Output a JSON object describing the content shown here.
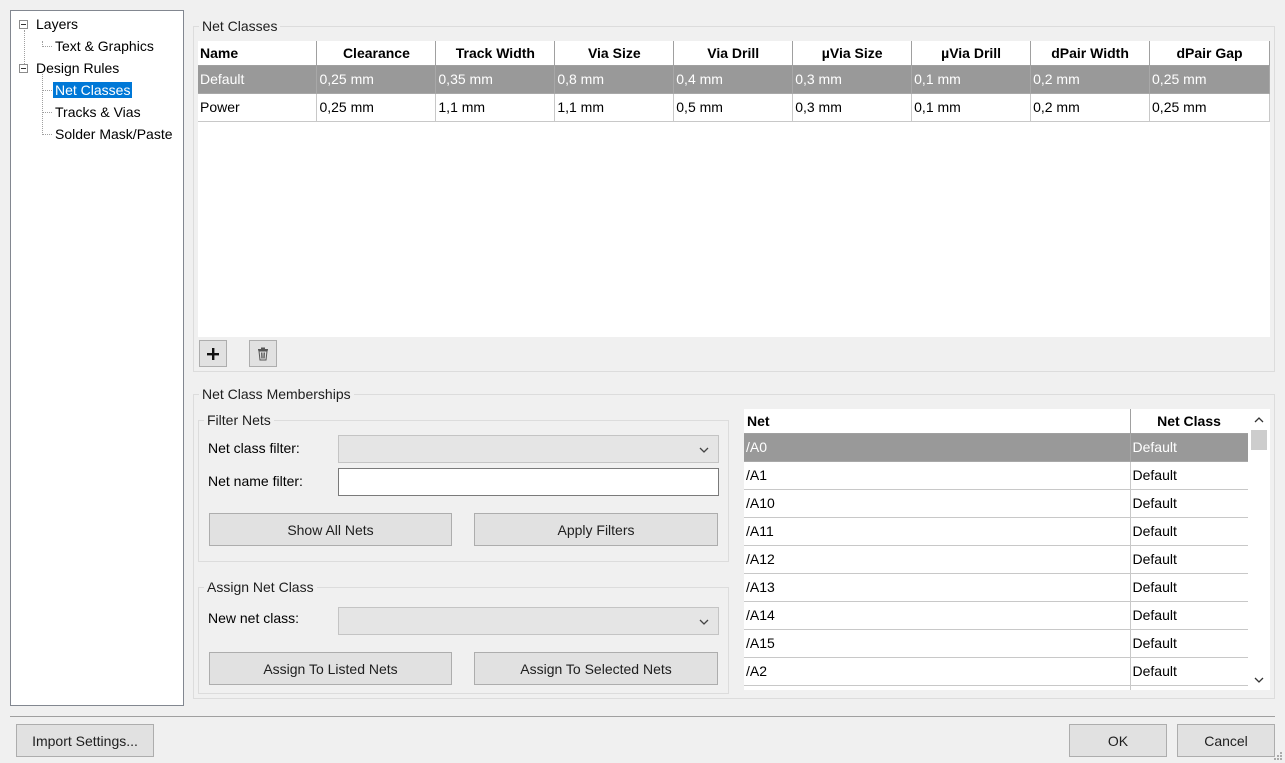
{
  "tree": {
    "items": [
      {
        "label": "Layers"
      },
      {
        "label": "Text & Graphics"
      },
      {
        "label": "Design Rules"
      },
      {
        "label": "Net Classes"
      },
      {
        "label": "Tracks & Vias"
      },
      {
        "label": "Solder Mask/Paste"
      }
    ],
    "selected": "Net Classes"
  },
  "net_classes": {
    "title": "Net Classes",
    "columns": [
      "Name",
      "Clearance",
      "Track Width",
      "Via Size",
      "Via Drill",
      "µVia Size",
      "µVia Drill",
      "dPair Width",
      "dPair Gap"
    ],
    "rows": [
      [
        "Default",
        "0,25 mm",
        "0,35 mm",
        "0,8 mm",
        "0,4 mm",
        "0,3 mm",
        "0,1 mm",
        "0,2 mm",
        "0,25 mm"
      ],
      [
        "Power",
        "0,25 mm",
        "1,1 mm",
        "1,1 mm",
        "0,5 mm",
        "0,3 mm",
        "0,1 mm",
        "0,2 mm",
        "0,25 mm"
      ]
    ],
    "selected_row": 0,
    "add_icon": "plus-icon",
    "delete_icon": "trash-icon"
  },
  "memberships": {
    "title": "Net Class Memberships",
    "filter": {
      "title": "Filter Nets",
      "class_filter_label": "Net class filter:",
      "class_filter_value": "",
      "name_filter_label": "Net name filter:",
      "name_filter_value": "",
      "show_all_label": "Show All Nets",
      "apply_label": "Apply Filters"
    },
    "assign": {
      "title": "Assign Net Class",
      "new_class_label": "New net class:",
      "new_class_value": "",
      "assign_listed_label": "Assign To Listed Nets",
      "assign_selected_label": "Assign To Selected Nets"
    },
    "net_list": {
      "columns": [
        "Net",
        "Net Class"
      ],
      "rows": [
        [
          "/A0",
          "Default"
        ],
        [
          "/A1",
          "Default"
        ],
        [
          "/A10",
          "Default"
        ],
        [
          "/A11",
          "Default"
        ],
        [
          "/A12",
          "Default"
        ],
        [
          "/A13",
          "Default"
        ],
        [
          "/A14",
          "Default"
        ],
        [
          "/A15",
          "Default"
        ],
        [
          "/A2",
          "Default"
        ]
      ],
      "selected_row": 0
    }
  },
  "footer": {
    "import_label": "Import Settings...",
    "ok_label": "OK",
    "cancel_label": "Cancel"
  }
}
